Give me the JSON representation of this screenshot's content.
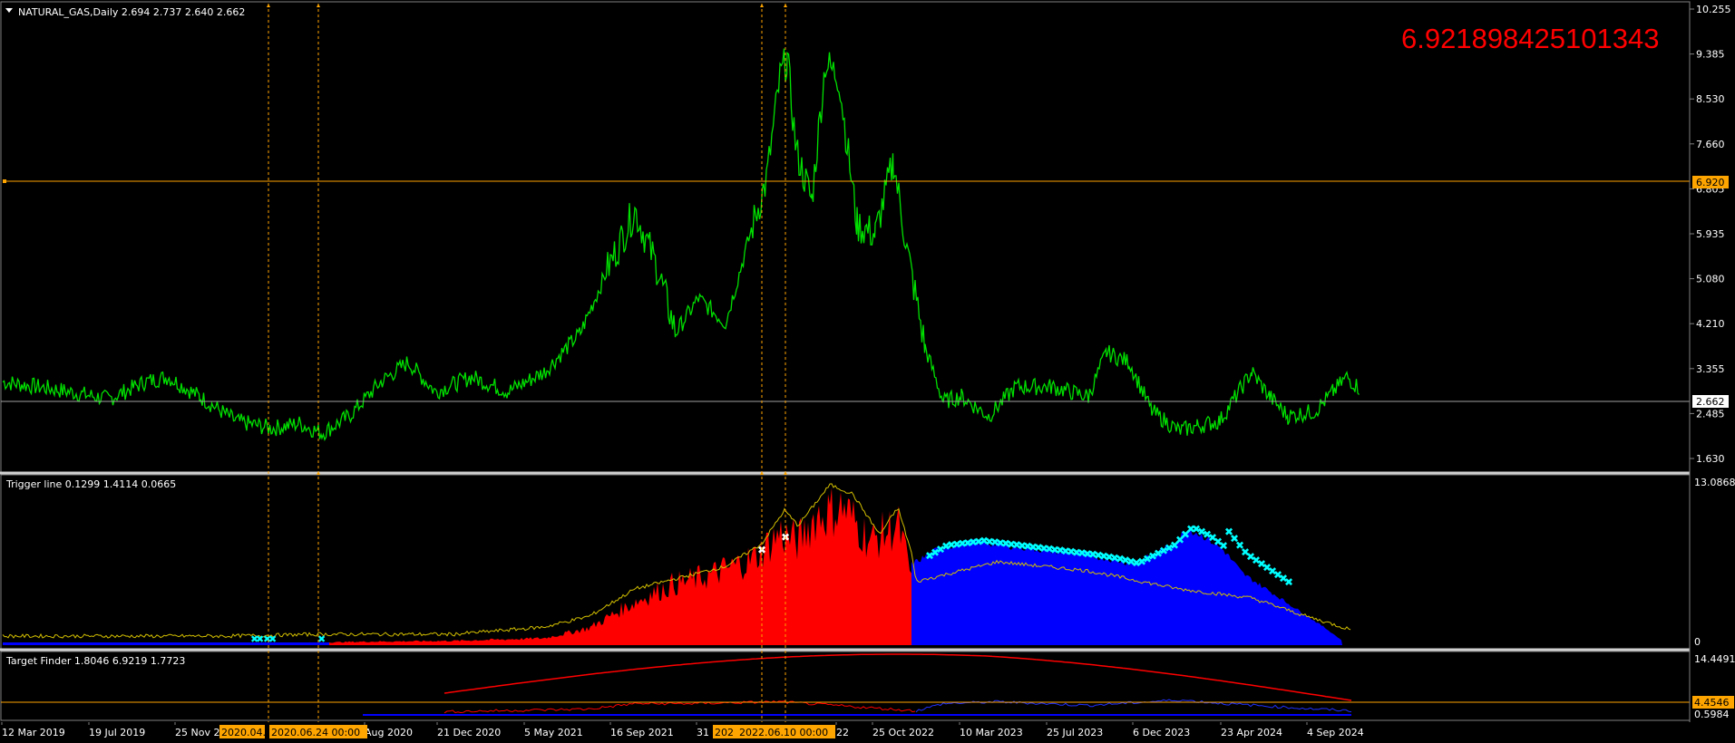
{
  "main_panel": {
    "title": "NATURAL_GAS,Daily  2.694 2.737 2.640 2.662",
    "overlay_value": "6.921898425101343",
    "price_axis": [
      "10.255",
      "9.385",
      "8.530",
      "7.660",
      "6.805",
      "5.935",
      "5.080",
      "4.210",
      "3.355",
      "2.485",
      "1.630"
    ],
    "hline_orange_label": "6.920",
    "hline_gray_label": "2.662",
    "price_range": [
      1.2,
      10.4
    ],
    "hline_orange_value": 6.92,
    "hline_gray_value": 2.662,
    "series_color": "#00e000"
  },
  "trigger_panel": {
    "title": "Trigger line 0.1299 1.4114 0.0665",
    "axis_top": "13.0868",
    "axis_bottom": "0"
  },
  "target_panel": {
    "title": "Target Finder 1.8046 6.9219 1.7723",
    "axis_top": "14.4491",
    "axis_orange": "4.4546",
    "axis_bottom": "0.5984"
  },
  "time_axis": [
    "12 Mar 2019",
    "19 Jul 2019",
    "25 Nov 2",
    "Aug 2020",
    "21 Dec 2020",
    "5 May 2021",
    "16 Sep 2021",
    "31",
    "22",
    "25 Oct 2022",
    "10 Mar 2023",
    "25 Jul 2023",
    "6 Dec 2023",
    "23 Apr 2024",
    "4 Sep 2024"
  ],
  "time_tags": [
    "2020.04.",
    "2020.06.24 00:00",
    "202",
    "2022.06.10 00:00"
  ],
  "colors": {
    "orange": "#ffa500",
    "red": "#ff0000",
    "blue": "#0000ff",
    "cyan": "#00ffff",
    "yellow": "#d4c000"
  }
}
